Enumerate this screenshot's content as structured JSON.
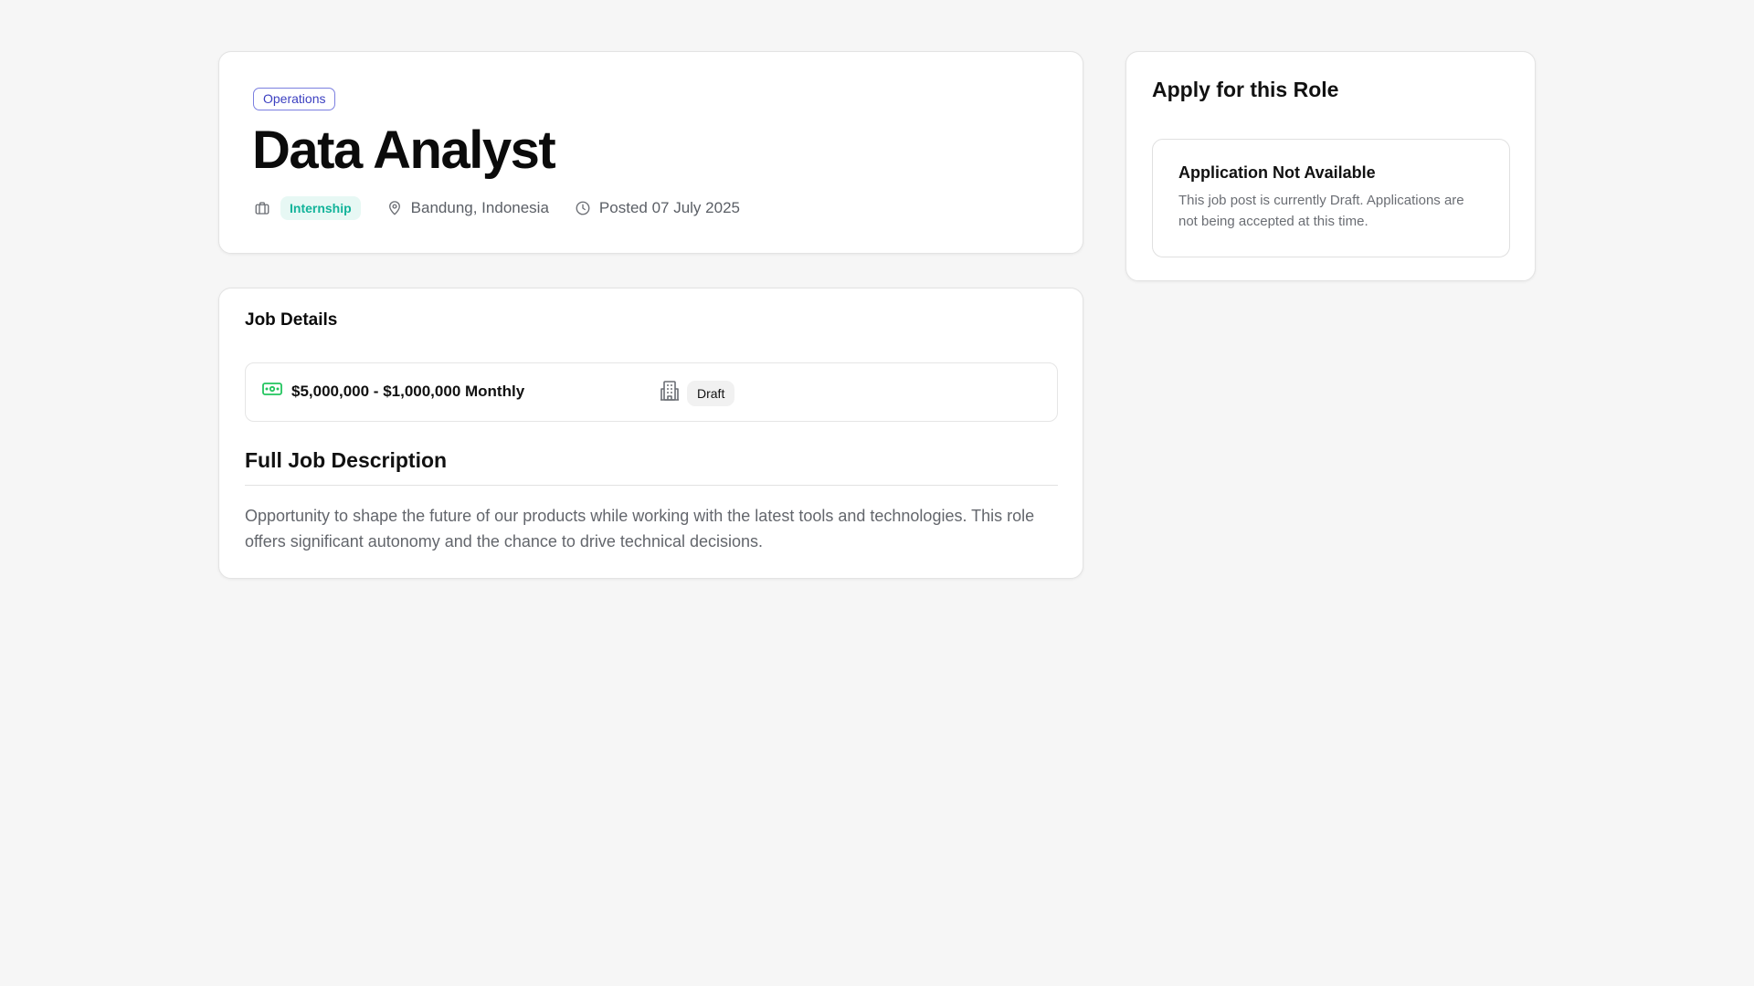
{
  "job": {
    "category": "Operations",
    "title": "Data Analyst",
    "type": "Internship",
    "location": "Bandung, Indonesia",
    "posted": "Posted 07 July 2025"
  },
  "details": {
    "heading": "Job Details",
    "salary": "$5,000,000 - $1,000,000 Monthly",
    "status": "Draft",
    "description_heading": "Full Job Description",
    "description": "Opportunity to shape the future of our products while working with the latest tools and technologies. This role offers significant autonomy and the chance to drive technical decisions."
  },
  "apply": {
    "heading": "Apply for this Role",
    "notice_title": "Application Not Available",
    "notice_text": "This job post is currently Draft. Applications are not being accepted at this time."
  },
  "icons": {
    "briefcase": "briefcase-icon",
    "location": "map-pin-icon",
    "clock": "clock-icon",
    "money": "money-icon",
    "building": "building-icon"
  },
  "colors": {
    "background": "#f6f6f6",
    "category_accent": "#3b3fc0",
    "type_accent": "#12b39a",
    "money_icon": "#22c55e"
  }
}
